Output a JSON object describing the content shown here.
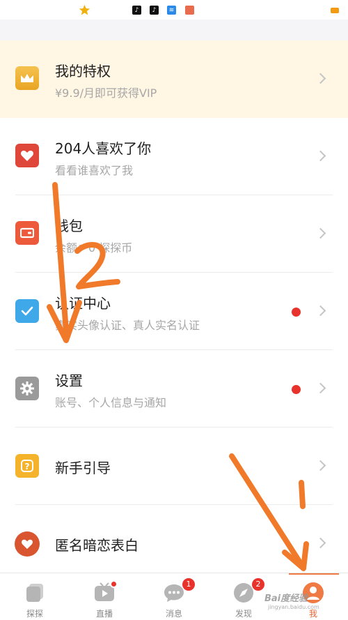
{
  "menu": {
    "privilege": {
      "title": "我的特权",
      "subtitle": "¥9.9/月即可获得VIP"
    },
    "likes": {
      "title": "204人喜欢了你",
      "subtitle": "看看谁喜欢了我"
    },
    "wallet": {
      "title": "钱包",
      "subtitle": "余额：0 探探币"
    },
    "verify": {
      "title": "认证中心",
      "subtitle": "真实头像认证、真人实名认证"
    },
    "settings": {
      "title": "设置",
      "subtitle": "账号、个人信息与通知"
    },
    "guide": {
      "title": "新手引导"
    },
    "confession": {
      "title": "匿名暗恋表白"
    }
  },
  "tabbar": {
    "tabs": [
      {
        "label": "探探"
      },
      {
        "label": "直播"
      },
      {
        "label": "消息",
        "badge": "1"
      },
      {
        "label": "发现",
        "badge": "2"
      },
      {
        "label": "我"
      }
    ]
  },
  "annotations": {
    "step_one": "1",
    "step_two": "2"
  },
  "watermark": {
    "text": "Bai度经验",
    "sub": "jingyan.baidu.com"
  },
  "colors": {
    "accent": "#ef7a43",
    "annotation": "#f07a2a",
    "badge": "#e8322c",
    "vip_bg": "#fff6e3"
  }
}
